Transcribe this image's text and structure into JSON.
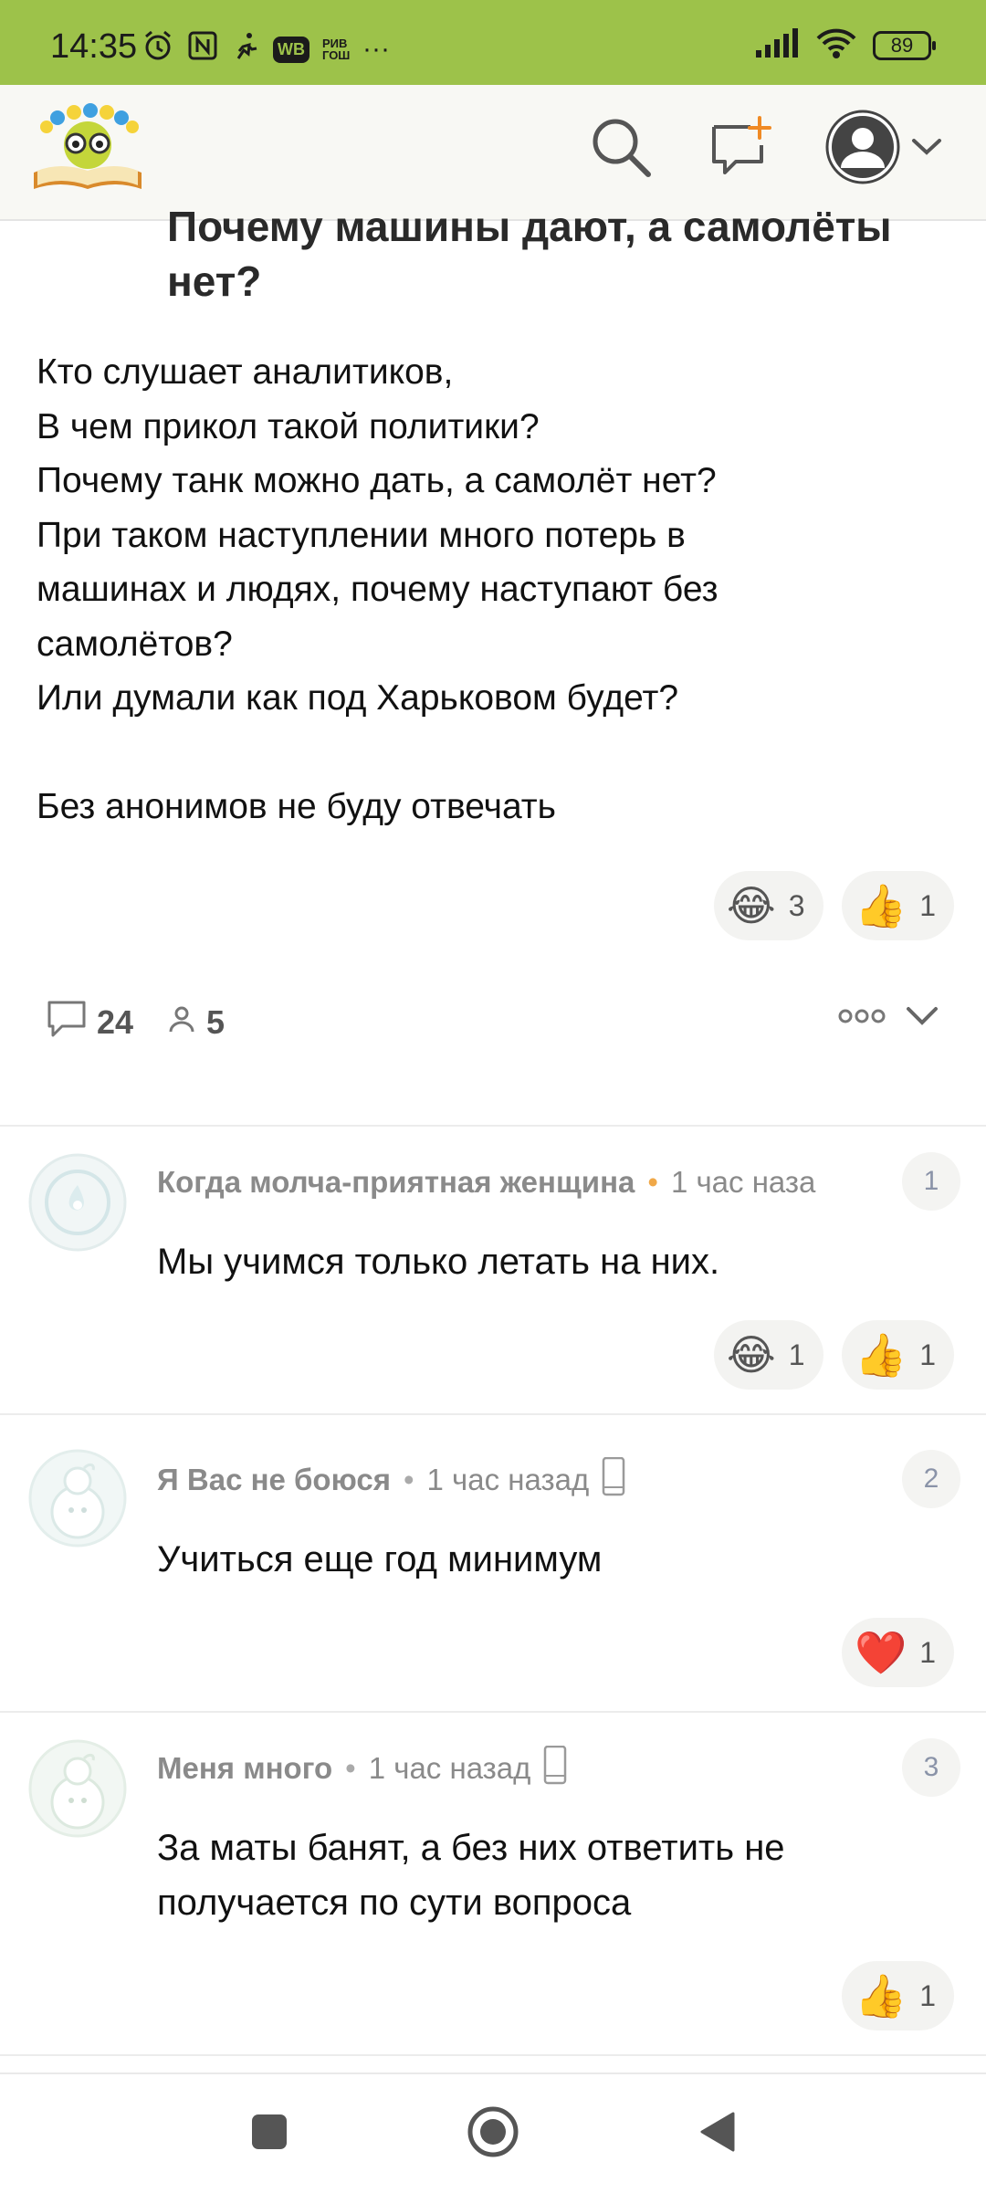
{
  "status_bar": {
    "time": "14:35",
    "battery": "89",
    "icons": [
      "alarm-icon",
      "nfc-icon",
      "running-icon",
      "wb-app-icon",
      "rivgosh-app-icon",
      "more-dots-icon",
      "signal-icon",
      "wifi-icon",
      "battery-icon"
    ],
    "wb_label": "WB",
    "rivgosh_label": "РИВ ГОШ",
    "overflow": "···"
  },
  "post": {
    "title": "Почему машины дают, а самолёты нет?",
    "body_lines": [
      "Кто слушает аналитиков,",
      "В чем прикол такой политики?",
      "Почему танк можно дать, а самолёт нет?",
      "При таком наступлении много потерь в",
      "машинах и людях, почему наступают без",
      "самолётов?",
      "Или думали как под Харьковом будет?",
      "",
      "Без анонимов не буду отвечать"
    ],
    "reactions": [
      {
        "emoji": "😂",
        "count": "3"
      },
      {
        "emoji": "👍",
        "count": "1"
      }
    ],
    "comments_count": "24",
    "subscribers_count": "5"
  },
  "comments": [
    {
      "author": "Когда молча-приятная женщина",
      "time": "1 час наза",
      "number": "1",
      "text": "Мы учимся только летать на них.",
      "reactions": [
        {
          "emoji": "😂",
          "count": "1"
        },
        {
          "emoji": "👍",
          "count": "1"
        }
      ]
    },
    {
      "author": "Я Вас не боюся",
      "time": "1 час назад",
      "number": "2",
      "text": "Учиться еще год минимум",
      "reactions": [
        {
          "emoji": "❤️",
          "count": "1"
        }
      ]
    },
    {
      "author": "Меня много",
      "time": "1 час назад",
      "number": "3",
      "text": "За маты банят, а без них ответить не получается по сути вопроса",
      "reactions": [
        {
          "emoji": "👍",
          "count": "1"
        }
      ]
    }
  ],
  "colors": {
    "status_bar": "#9dc24a",
    "accent_orange": "#f0a848"
  }
}
